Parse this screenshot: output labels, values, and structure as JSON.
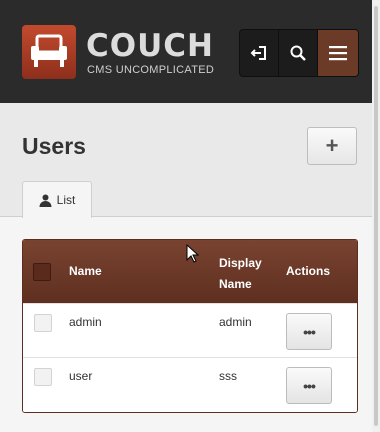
{
  "header": {
    "brand_title": "COUCH",
    "brand_tagline": "CMS UNCOMPLICATED",
    "icons": [
      "logout-icon",
      "search-icon",
      "menu-icon"
    ]
  },
  "page": {
    "title": "Users",
    "add_label": "+",
    "tab_list_label": "List"
  },
  "table": {
    "columns": [
      "Name",
      "Display Name",
      "Actions"
    ],
    "rows": [
      {
        "name": "admin",
        "display_name": "admin",
        "action": "•••"
      },
      {
        "name": "user",
        "display_name": "sss",
        "action": "•••"
      }
    ]
  },
  "colors": {
    "header_bg": "#2b2b2b",
    "accent": "#6b3b27",
    "logo": "#b1442a"
  }
}
